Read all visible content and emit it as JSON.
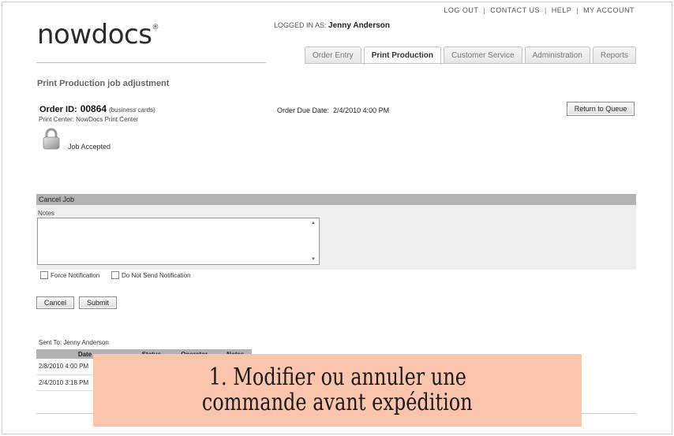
{
  "top_links": [
    "LOG OUT",
    "CONTACT US",
    "HELP",
    "MY ACCOUNT"
  ],
  "logo": {
    "text": "nowdocs",
    "mark": "®"
  },
  "user": {
    "label": "LOGGED IN AS:",
    "name": "Jenny Anderson"
  },
  "tabs": [
    {
      "label": "Order Entry",
      "active": false
    },
    {
      "label": "Print Production",
      "active": true
    },
    {
      "label": "Customer Service",
      "active": false
    },
    {
      "label": "Administration",
      "active": false
    },
    {
      "label": "Reports",
      "active": false
    }
  ],
  "page_title": "Print Production  job adjustment",
  "order": {
    "id_label": "Order ID:",
    "id": "00864",
    "type": "(business cards)",
    "print_center": "Print Center: NowDocs Print Center",
    "due_label": "Order Due Date:",
    "due_value": "2/4/2010 4:00 PM",
    "return_button": "Return to Queue",
    "status_icon": "lock-icon",
    "status": "Job Accepted"
  },
  "cancel_panel": {
    "header": "Cancel Job",
    "notes_label": "Notes",
    "notes_value": "",
    "force_notification": "Force Notification",
    "do_not_send": "Do Not Send Notification",
    "cancel_button": "Cancel",
    "submit_button": "Submit"
  },
  "history": {
    "sent_to": "Sent To: Jenny Anderson",
    "columns": [
      "Date",
      "Status",
      "Operator",
      "Notes"
    ],
    "rows": [
      {
        "date": "2/8/2010 4:00 PM"
      },
      {
        "date": "2/4/2010 3:18 PM"
      }
    ]
  },
  "banner": {
    "line1": "1. Modifier ou annuler une",
    "line2": "commande avant expédition"
  },
  "colors": {
    "panel_header": "#b3b3b3",
    "panel_body": "#eeeeee",
    "banner": "#fbc4ad"
  }
}
